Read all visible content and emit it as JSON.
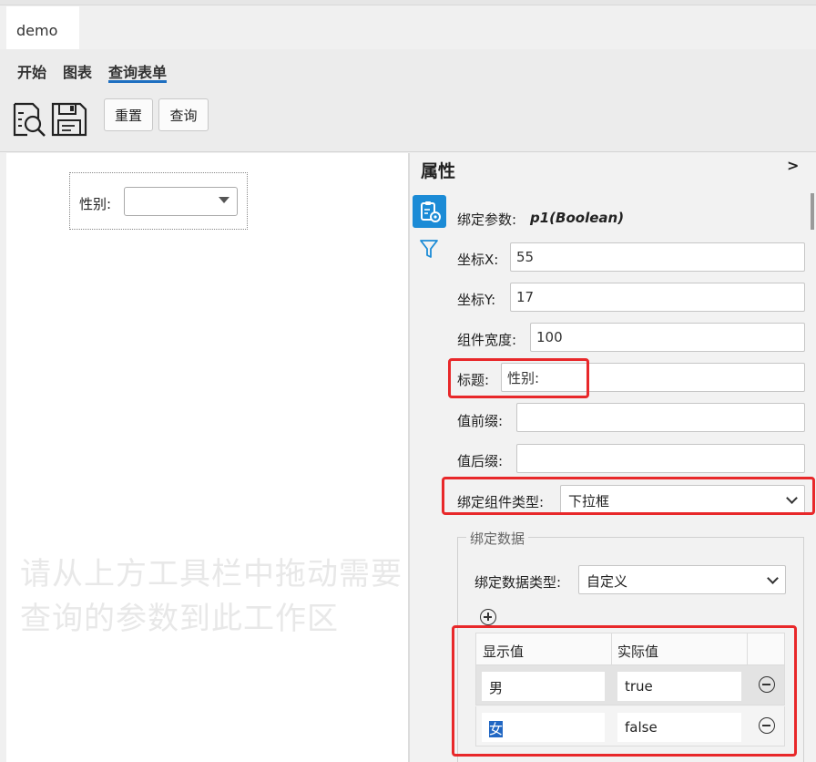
{
  "window": {
    "tab_title": "demo"
  },
  "menu": {
    "items": [
      "开始",
      "图表",
      "查询表单"
    ],
    "active": "查询表单",
    "accent_color": "#1e6fc0"
  },
  "toolbar": {
    "icons": [
      "preview-icon",
      "save-icon"
    ],
    "reset_label": "重置",
    "query_label": "查询"
  },
  "canvas": {
    "form_field": {
      "label": "性别:",
      "value": ""
    },
    "hint": "请从上方工具栏中拖动需要查询的参数到此工作区"
  },
  "panel": {
    "title": "属性",
    "collapse_label": ">",
    "bind_param_label": "绑定参数:",
    "bind_param_value": "p1(Boolean)",
    "x_label": "坐标X:",
    "x_value": "55",
    "y_label": "坐标Y:",
    "y_value": "17",
    "width_label": "组件宽度:",
    "width_value": "100",
    "caption_label": "标题:",
    "caption_value": "性别:",
    "prefix_label": "值前缀:",
    "prefix_value": "",
    "suffix_label": "值后缀:",
    "suffix_value": "",
    "component_type_label": "绑定组件类型:",
    "component_type_value": "下拉框",
    "bind_data": {
      "group_title": "绑定数据",
      "data_type_label": "绑定数据类型:",
      "data_type_value": "自定义",
      "columns": [
        "显示值",
        "实际值"
      ],
      "rows": [
        {
          "display": "男",
          "actual": "true"
        },
        {
          "display": "女",
          "actual": "false"
        }
      ]
    },
    "highlight_color": "#e8282a",
    "active_tab_color": "#1b8bd6"
  }
}
